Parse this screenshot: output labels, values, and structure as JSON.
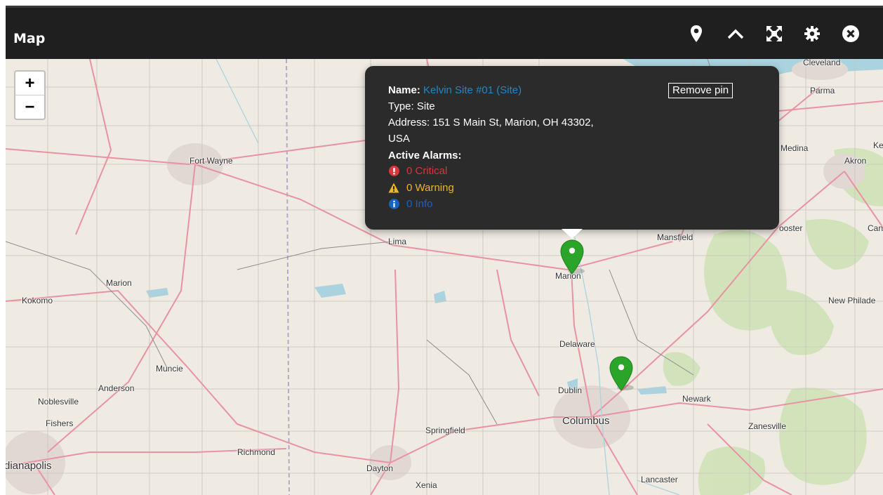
{
  "header": {
    "title": "Map"
  },
  "icons": [
    "map-marker-icon",
    "chevron-up-icon",
    "expand-icon",
    "gear-icon",
    "close-circle-icon"
  ],
  "zoom": {
    "in_label": "+",
    "out_label": "−"
  },
  "map_labels": {
    "cleveland": "Cleveland",
    "parma": "Parma",
    "medina": "Medina",
    "akron": "Akron",
    "ke": "Ke",
    "fort_wayne": "Fort Wayne",
    "lima": "Lima",
    "mansfield": "Mansfield",
    "wooster": "ooster",
    "can": "Can",
    "marion_in": "Marion",
    "kokomo": "Kokomo",
    "marion_oh": "Marion",
    "new_philadelphia": "New Philade",
    "delaware": "Delaware",
    "muncie": "Muncie",
    "anderson": "Anderson",
    "noblesville": "Noblesville",
    "dublin": "Dublin",
    "newark": "Newark",
    "fishers": "Fishers",
    "columbus": "Columbus",
    "zanesville": "Zanesville",
    "springfield": "Springfield",
    "richmond": "Richmond",
    "indianapolis": "dianapolis",
    "dayton": "Dayton",
    "xenia": "Xenia",
    "lancaster": "Lancaster"
  },
  "popup": {
    "name_label": "Name:",
    "name_value": "Kelvin Site #01 (Site)",
    "type_line": "Type: Site",
    "address_line1": "Address: 151 S Main St, Marion, OH 43302,",
    "address_line2": "USA",
    "alarms_heading": "Active Alarms:",
    "critical": "0 Critical",
    "warning": "0 Warning",
    "info": "0 Info",
    "remove_pin_label": "Remove pin"
  },
  "colors": {
    "header_bg": "#1f1f1f",
    "popup_bg": "#2b2b2b",
    "link_blue": "#1e88c9",
    "critical_red": "#d9363e",
    "warning_yellow": "#f0b429",
    "info_blue": "#1565c0",
    "pin_green": "#2aa52a"
  }
}
